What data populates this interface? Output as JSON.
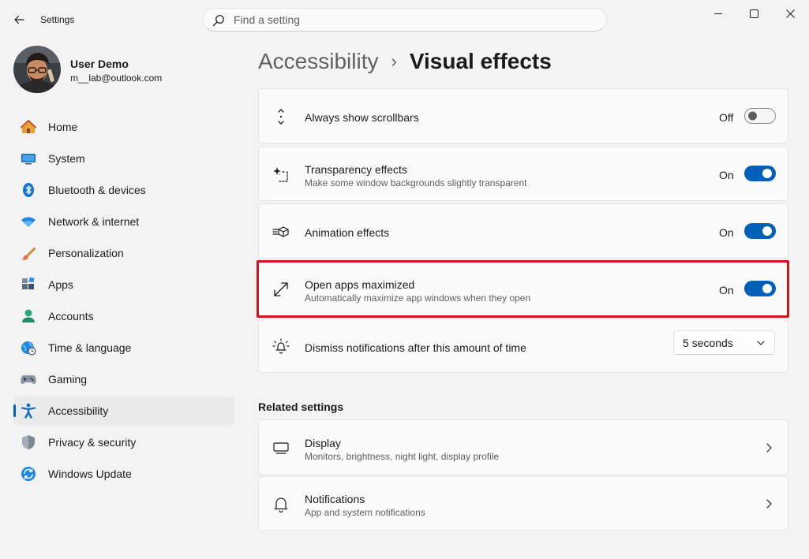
{
  "window": {
    "app_title": "Settings"
  },
  "search": {
    "placeholder": "Find a setting"
  },
  "user": {
    "name": "User Demo",
    "email": "m__lab@outlook.com"
  },
  "sidebar": {
    "items": [
      {
        "label": "Home",
        "icon": "home-icon"
      },
      {
        "label": "System",
        "icon": "system-icon"
      },
      {
        "label": "Bluetooth & devices",
        "icon": "bluetooth-icon"
      },
      {
        "label": "Network & internet",
        "icon": "wifi-icon"
      },
      {
        "label": "Personalization",
        "icon": "brush-icon"
      },
      {
        "label": "Apps",
        "icon": "apps-icon"
      },
      {
        "label": "Accounts",
        "icon": "accounts-icon"
      },
      {
        "label": "Time & language",
        "icon": "clock-globe-icon"
      },
      {
        "label": "Gaming",
        "icon": "gamepad-icon"
      },
      {
        "label": "Accessibility",
        "icon": "accessibility-icon",
        "selected": true
      },
      {
        "label": "Privacy & security",
        "icon": "shield-icon"
      },
      {
        "label": "Windows Update",
        "icon": "update-icon"
      }
    ]
  },
  "breadcrumb": {
    "parent": "Accessibility",
    "separator": "›",
    "current": "Visual effects"
  },
  "settings": {
    "scrollbars": {
      "title": "Always show scrollbars",
      "state": "Off",
      "enabled": false
    },
    "transparency": {
      "title": "Transparency effects",
      "description": "Make some window backgrounds slightly transparent",
      "state": "On",
      "enabled": true
    },
    "animation": {
      "title": "Animation effects",
      "state": "On",
      "enabled": true
    },
    "maximized": {
      "title": "Open apps maximized",
      "description": "Automatically maximize app windows when they open",
      "state": "On",
      "enabled": true
    },
    "notifications_timeout": {
      "title": "Dismiss notifications after this amount of time",
      "value": "5 seconds"
    }
  },
  "related": {
    "heading": "Related settings",
    "display": {
      "title": "Display",
      "description": "Monitors, brightness, night light, display profile"
    },
    "notifications": {
      "title": "Notifications",
      "description": "App and system notifications"
    }
  },
  "colors": {
    "accent": "#005fb8",
    "highlight_border": "#d0131c",
    "background": "#f3f3f3",
    "card": "#fbfbfb"
  }
}
